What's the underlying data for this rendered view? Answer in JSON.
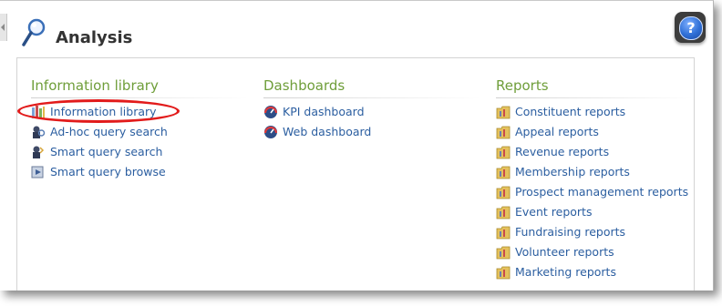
{
  "page": {
    "title": "Analysis",
    "title_icon": "magnifier-icon",
    "help_label": "?"
  },
  "sections": [
    {
      "heading": "Information library",
      "items": [
        {
          "label": "Information library",
          "icon": "library-icon"
        },
        {
          "label": "Ad-hoc query search",
          "icon": "query-icon"
        },
        {
          "label": "Smart query search",
          "icon": "smart-query-icon"
        },
        {
          "label": "Smart query browse",
          "icon": "browse-icon"
        }
      ]
    },
    {
      "heading": "Dashboards",
      "items": [
        {
          "label": "KPI dashboard",
          "icon": "dashboard-icon"
        },
        {
          "label": "Web dashboard",
          "icon": "dashboard-icon"
        }
      ]
    },
    {
      "heading": "Reports",
      "items": [
        {
          "label": "Constituent reports",
          "icon": "report-folder-icon"
        },
        {
          "label": "Appeal reports",
          "icon": "report-folder-icon"
        },
        {
          "label": "Revenue reports",
          "icon": "report-folder-icon"
        },
        {
          "label": "Membership reports",
          "icon": "report-folder-icon"
        },
        {
          "label": "Prospect management reports",
          "icon": "report-folder-icon"
        },
        {
          "label": "Event reports",
          "icon": "report-folder-icon"
        },
        {
          "label": "Fundraising reports",
          "icon": "report-folder-icon"
        },
        {
          "label": "Volunteer reports",
          "icon": "report-folder-icon"
        },
        {
          "label": "Marketing reports",
          "icon": "report-folder-icon"
        }
      ]
    }
  ],
  "colors": {
    "heading": "#6f9e3a",
    "link": "#2b5ea0",
    "annotation": "#e21b1b"
  }
}
